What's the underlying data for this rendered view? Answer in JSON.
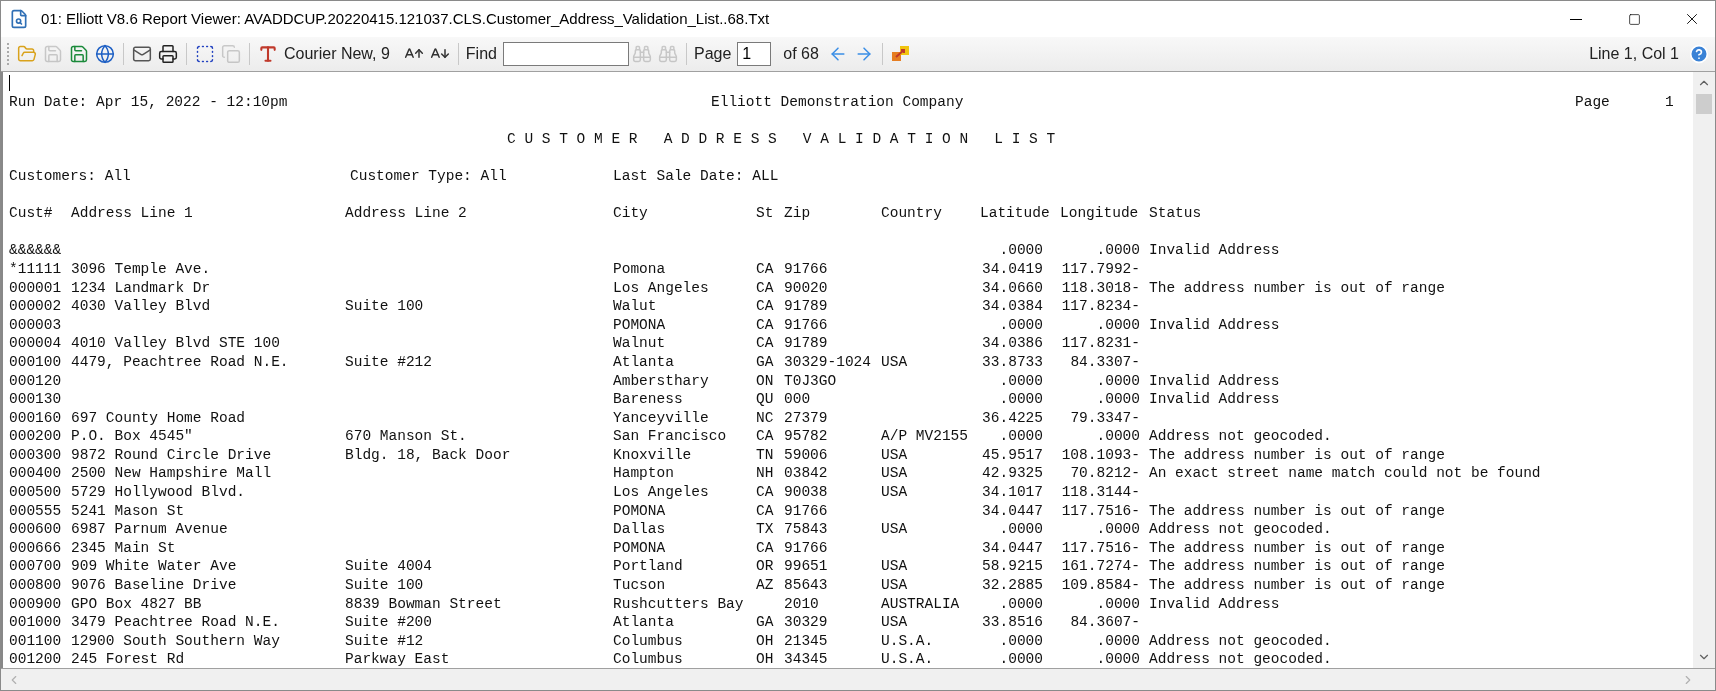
{
  "window": {
    "title": "01: Elliott V8.6 Report Viewer: AVADDCUP.20220415.121037.CLS.Customer_Address_Validation_List..68.Txt"
  },
  "toolbar": {
    "items": [
      {
        "kind": "open",
        "disabled": false
      },
      {
        "kind": "save",
        "disabled": true
      },
      {
        "kind": "save_as",
        "disabled": false
      },
      {
        "kind": "web",
        "disabled": false
      },
      {
        "kind": "separator"
      },
      {
        "kind": "mail",
        "disabled": false
      },
      {
        "kind": "print",
        "disabled": false
      },
      {
        "kind": "separator"
      },
      {
        "kind": "select",
        "disabled": false
      },
      {
        "kind": "copy",
        "disabled": true
      },
      {
        "kind": "separator"
      },
      {
        "kind": "font",
        "label": "Courier New, 9",
        "disabled": false
      },
      {
        "kind": "grow",
        "disabled": false
      },
      {
        "kind": "shrink",
        "disabled": false
      },
      {
        "kind": "separator"
      },
      {
        "kind": "find",
        "label": "Find"
      },
      {
        "kind": "find_next",
        "disabled": true
      },
      {
        "kind": "find_prev",
        "disabled": true
      },
      {
        "kind": "separator"
      },
      {
        "kind": "page",
        "label": "Page",
        "value": "1",
        "total": "of 68"
      },
      {
        "kind": "back",
        "disabled": false
      },
      {
        "kind": "forward",
        "disabled": false
      },
      {
        "kind": "separator"
      },
      {
        "kind": "send",
        "disabled": false
      }
    ],
    "position": "Line 1, Col 1"
  },
  "report": {
    "run_date": "Run Date: Apr 15, 2022 - 12:10pm",
    "company": "Elliott Demonstration Company",
    "page_label": "Page",
    "page_number": "1",
    "title": "C U S T O M E R   A D D R E S S   V A L I D A T I O N   L I S T",
    "filters": [
      "Customers: All",
      "Customer Type: All",
      "Last Sale Date: ALL"
    ],
    "columns": [
      "Cust#",
      "Address Line 1",
      "Address Line 2",
      "City",
      "St",
      "Zip",
      "Country",
      "Latitude",
      "Longitude",
      "Status"
    ],
    "rows": [
      {
        "cust": "&&&&&&",
        "address1": "",
        "address2": "",
        "city": "",
        "st": "",
        "zip": "",
        "country": "",
        "latitude": ".0000",
        "longitude": ".0000",
        "status": "Invalid Address"
      },
      {
        "cust": "*11111",
        "address1": "3096 Temple Ave.",
        "address2": "",
        "city": "Pomona",
        "st": "CA",
        "zip": "91766",
        "country": "",
        "latitude": "34.0419",
        "longitude": "117.7992-",
        "status": ""
      },
      {
        "cust": "000001",
        "address1": "1234 Landmark Dr",
        "address2": "",
        "city": "Los Angeles",
        "st": "CA",
        "zip": "90020",
        "country": "",
        "latitude": "34.0660",
        "longitude": "118.3018-",
        "status": "The address number is out of range"
      },
      {
        "cust": "000002",
        "address1": "4030 Valley Blvd",
        "address2": "Suite 100",
        "city": "Walut",
        "st": "CA",
        "zip": "91789",
        "country": "",
        "latitude": "34.0384",
        "longitude": "117.8234-",
        "status": ""
      },
      {
        "cust": "000003",
        "address1": "",
        "address2": "",
        "city": "POMONA",
        "st": "CA",
        "zip": "91766",
        "country": "",
        "latitude": ".0000",
        "longitude": ".0000",
        "status": "Invalid Address"
      },
      {
        "cust": "000004",
        "address1": "4010 Valley Blvd STE 100",
        "address2": "",
        "city": "Walnut",
        "st": "CA",
        "zip": "91789",
        "country": "",
        "latitude": "34.0386",
        "longitude": "117.8231-",
        "status": ""
      },
      {
        "cust": "000100",
        "address1": "4479, Peachtree Road N.E.",
        "address2": "Suite #212",
        "city": "Atlanta",
        "st": "GA",
        "zip": "30329-1024",
        "country": "USA",
        "latitude": "33.8733",
        "longitude": "84.3307-",
        "status": ""
      },
      {
        "cust": "000120",
        "address1": "",
        "address2": "",
        "city": "Ambersthary",
        "st": "ON",
        "zip": "T0J3GO",
        "country": "",
        "latitude": ".0000",
        "longitude": ".0000",
        "status": "Invalid Address"
      },
      {
        "cust": "000130",
        "address1": "",
        "address2": "",
        "city": "Bareness",
        "st": "QU",
        "zip": "000",
        "country": "",
        "latitude": ".0000",
        "longitude": ".0000",
        "status": "Invalid Address"
      },
      {
        "cust": "000160",
        "address1": "697 County Home Road",
        "address2": "",
        "city": "Yanceyville",
        "st": "NC",
        "zip": "27379",
        "country": "",
        "latitude": "36.4225",
        "longitude": "79.3347-",
        "status": ""
      },
      {
        "cust": "000200",
        "address1": "P.O. Box 4545\"",
        "address2": "670 Manson St.",
        "city": "San Francisco",
        "st": "CA",
        "zip": "95782",
        "country": "A/P MV2155",
        "latitude": ".0000",
        "longitude": ".0000",
        "status": "Address not geocoded."
      },
      {
        "cust": "000300",
        "address1": "9872 Round Circle Drive",
        "address2": "Bldg. 18, Back Door",
        "city": "Knoxville",
        "st": "TN",
        "zip": "59006",
        "country": "USA",
        "latitude": "45.9517",
        "longitude": "108.1093-",
        "status": "The address number is out of range"
      },
      {
        "cust": "000400",
        "address1": "2500 New Hampshire Mall",
        "address2": "",
        "city": "Hampton",
        "st": "NH",
        "zip": "03842",
        "country": "USA",
        "latitude": "42.9325",
        "longitude": "70.8212-",
        "status": "An exact street name match could not be found"
      },
      {
        "cust": "000500",
        "address1": "5729 Hollywood Blvd.",
        "address2": "",
        "city": "Los Angeles",
        "st": "CA",
        "zip": "90038",
        "country": "USA",
        "latitude": "34.1017",
        "longitude": "118.3144-",
        "status": ""
      },
      {
        "cust": "000555",
        "address1": "5241 Mason St",
        "address2": "",
        "city": "POMONA",
        "st": "CA",
        "zip": "91766",
        "country": "",
        "latitude": "34.0447",
        "longitude": "117.7516-",
        "status": "The address number is out of range"
      },
      {
        "cust": "000600",
        "address1": "6987 Parnum Avenue",
        "address2": "",
        "city": "Dallas",
        "st": "TX",
        "zip": "75843",
        "country": "USA",
        "latitude": ".0000",
        "longitude": ".0000",
        "status": "Address not geocoded."
      },
      {
        "cust": "000666",
        "address1": "2345 Main St",
        "address2": "",
        "city": "POMONA",
        "st": "CA",
        "zip": "91766",
        "country": "",
        "latitude": "34.0447",
        "longitude": "117.7516-",
        "status": "The address number is out of range"
      },
      {
        "cust": "000700",
        "address1": "909 White Water Ave",
        "address2": "Suite 4004",
        "city": "Portland",
        "st": "OR",
        "zip": "99651",
        "country": "USA",
        "latitude": "58.9215",
        "longitude": "161.7274-",
        "status": "The address number is out of range"
      },
      {
        "cust": "000800",
        "address1": "9076 Baseline Drive",
        "address2": "Suite 100",
        "city": "Tucson",
        "st": "AZ",
        "zip": "85643",
        "country": "USA",
        "latitude": "32.2885",
        "longitude": "109.8584-",
        "status": "The address number is out of range"
      },
      {
        "cust": "000900",
        "address1": "GPO Box 4827 BB",
        "address2": "8839 Bowman Street",
        "city": "Rushcutters Bay",
        "st": "",
        "zip": "2010",
        "country": "AUSTRALIA",
        "latitude": ".0000",
        "longitude": ".0000",
        "status": "Invalid Address"
      },
      {
        "cust": "001000",
        "address1": "3479 Peachtree Road N.E.",
        "address2": "Suite #200",
        "city": "Atlanta",
        "st": "GA",
        "zip": "30329",
        "country": "USA",
        "latitude": "33.8516",
        "longitude": "84.3607-",
        "status": ""
      },
      {
        "cust": "001100",
        "address1": "12900 South Southern Way",
        "address2": "Suite #12",
        "city": "Columbus",
        "st": "OH",
        "zip": "21345",
        "country": "U.S.A.",
        "latitude": ".0000",
        "longitude": ".0000",
        "status": "Address not geocoded."
      },
      {
        "cust": "001200",
        "address1": "245 Forest Rd",
        "address2": "Parkway East",
        "city": "Columbus",
        "st": "OH",
        "zip": "34345",
        "country": "U.S.A.",
        "latitude": ".0000",
        "longitude": ".0000",
        "status": "Address not geocoded."
      }
    ]
  }
}
